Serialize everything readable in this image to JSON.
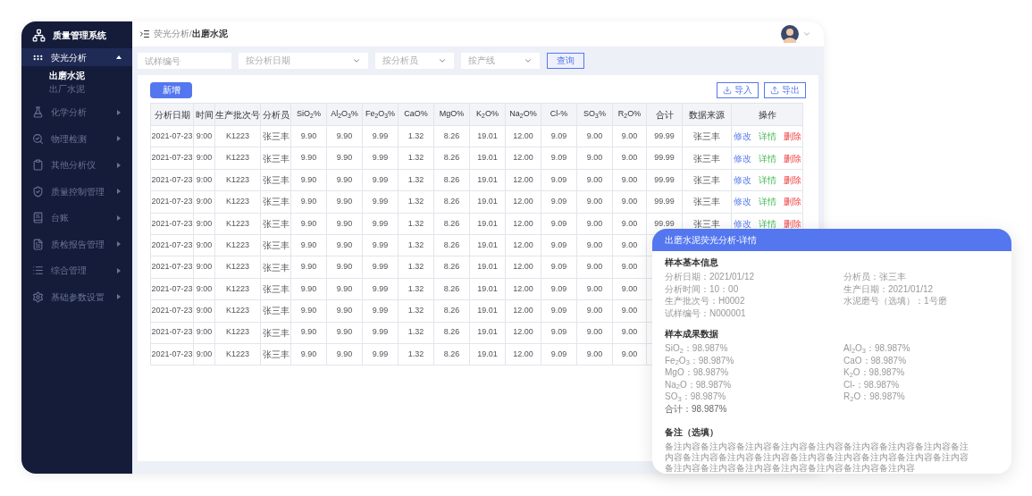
{
  "sidebar": {
    "title": "质量管理系统",
    "items": [
      {
        "label": "荧光分析",
        "expanded": true,
        "selected": true,
        "children": [
          {
            "label": "出磨水泥",
            "selected": true
          },
          {
            "label": "出厂水泥",
            "selected": false
          }
        ]
      },
      {
        "label": "化学分析",
        "expanded": false,
        "selected": false
      },
      {
        "label": "物理检测",
        "expanded": false,
        "selected": false
      },
      {
        "label": "其他分析仪",
        "expanded": false,
        "selected": false
      },
      {
        "label": "质量控制管理",
        "expanded": false,
        "selected": false
      },
      {
        "label": "台账",
        "expanded": false,
        "selected": false
      },
      {
        "label": "质检报告管理",
        "expanded": false,
        "selected": false
      },
      {
        "label": "综合管理",
        "expanded": false,
        "selected": false
      },
      {
        "label": "基础参数设置",
        "expanded": false,
        "selected": false
      }
    ]
  },
  "breadcrumb": {
    "parent": "荧光分析/",
    "current": "出磨水泥"
  },
  "filters": [
    {
      "kind": "input",
      "placeholder": "试样编号"
    },
    {
      "kind": "select",
      "placeholder": "按分析日期"
    },
    {
      "kind": "select",
      "placeholder": "按分析员"
    },
    {
      "kind": "select",
      "placeholder": "按产线"
    }
  ],
  "query_button": "查询",
  "add_button": "新增",
  "import_button": "导入",
  "export_button": "导出",
  "table": {
    "columns": [
      "分析日期",
      "时间",
      "生产批次号",
      "分析员",
      "SiO$_{2}$%",
      "Al$_{2}$O$_{3}$%",
      "Fe$_{2}$O$_{3}$%",
      "CaO%",
      "MgO%",
      "K$_{2}$O%",
      "Na$_{2}$O%",
      "Cl-%",
      "SO$_{3}$%",
      "R$_{2}$O%",
      "合计",
      "数据来源",
      "操作"
    ],
    "rows": [
      {
        "cells": [
          "2021-07-23",
          "9:00",
          "K1223",
          "张三丰",
          "9.90",
          "9.90",
          "9.99",
          "1.32",
          "8.26",
          "19.01",
          "12.00",
          "9.09",
          "9.00",
          "9.00",
          "99.99",
          "张三丰"
        ],
        "actions": [
          {
            "kind": "edit",
            "label": "修改"
          },
          {
            "kind": "detail",
            "label": "详情"
          },
          {
            "kind": "delete",
            "label": "删除"
          }
        ]
      },
      {
        "cells": [
          "2021-07-23",
          "9:00",
          "K1223",
          "张三丰",
          "9.90",
          "9.90",
          "9.99",
          "1.32",
          "8.26",
          "19.01",
          "12.00",
          "9.09",
          "9.00",
          "9.00",
          "99.99",
          "张三丰"
        ],
        "actions": [
          {
            "kind": "edit",
            "label": "修改"
          },
          {
            "kind": "detail",
            "label": "详情"
          },
          {
            "kind": "delete",
            "label": "删除"
          }
        ]
      },
      {
        "cells": [
          "2021-07-23",
          "9:00",
          "K1223",
          "张三丰",
          "9.90",
          "9.90",
          "9.99",
          "1.32",
          "8.26",
          "19.01",
          "12.00",
          "9.09",
          "9.00",
          "9.00",
          "99.99",
          "张三丰"
        ],
        "actions": [
          {
            "kind": "edit",
            "label": "修改"
          },
          {
            "kind": "detail",
            "label": "详情"
          },
          {
            "kind": "delete",
            "label": "删除"
          }
        ]
      },
      {
        "cells": [
          "2021-07-23",
          "9:00",
          "K1223",
          "张三丰",
          "9.90",
          "9.90",
          "9.99",
          "1.32",
          "8.26",
          "19.01",
          "12.00",
          "9.09",
          "9.00",
          "9.00",
          "99.99",
          "张三丰"
        ],
        "actions": [
          {
            "kind": "edit",
            "label": "修改"
          },
          {
            "kind": "detail",
            "label": "详情"
          },
          {
            "kind": "delete",
            "label": "删除"
          }
        ]
      },
      {
        "cells": [
          "2021-07-23",
          "9:00",
          "K1223",
          "张三丰",
          "9.90",
          "9.90",
          "9.99",
          "1.32",
          "8.26",
          "19.01",
          "12.00",
          "9.09",
          "9.00",
          "9.00",
          "99.99",
          "张三丰"
        ],
        "actions": [
          {
            "kind": "edit",
            "label": "修改"
          },
          {
            "kind": "detail",
            "label": "详情"
          },
          {
            "kind": "delete",
            "label": "删除"
          }
        ]
      },
      {
        "cells": [
          "2021-07-23",
          "9:00",
          "K1223",
          "张三丰",
          "9.90",
          "9.90",
          "9.99",
          "1.32",
          "8.26",
          "19.01",
          "12.00",
          "9.09",
          "9.00",
          "9.00"
        ]
      },
      {
        "cells": [
          "2021-07-23",
          "9:00",
          "K1223",
          "张三丰",
          "9.90",
          "9.90",
          "9.99",
          "1.32",
          "8.26",
          "19.01",
          "12.00",
          "9.09",
          "9.00",
          "9.00"
        ]
      },
      {
        "cells": [
          "2021-07-23",
          "9:00",
          "K1223",
          "张三丰",
          "9.90",
          "9.90",
          "9.99",
          "1.32",
          "8.26",
          "19.01",
          "12.00",
          "9.09",
          "9.00",
          "9.00"
        ]
      },
      {
        "cells": [
          "2021-07-23",
          "9:00",
          "K1223",
          "张三丰",
          "9.90",
          "9.90",
          "9.99",
          "1.32",
          "8.26",
          "19.01",
          "12.00",
          "9.09",
          "9.00",
          "9.00"
        ]
      },
      {
        "cells": [
          "2021-07-23",
          "9:00",
          "K1223",
          "张三丰",
          "9.90",
          "9.90",
          "9.99",
          "1.32",
          "8.26",
          "19.01",
          "12.00",
          "9.09",
          "9.00",
          "9.00"
        ]
      },
      {
        "cells": [
          "2021-07-23",
          "9:00",
          "K1223",
          "张三丰",
          "9.90",
          "9.90",
          "9.99",
          "1.32",
          "8.26",
          "19.01",
          "12.00",
          "9.09",
          "9.00",
          "9.00"
        ]
      }
    ]
  },
  "detail": {
    "title": "出磨水泥荧光分析-详情",
    "basic_title": "样本基本信息",
    "basic_left": [
      "分析日期：2021/01/12",
      "分析时间：10：00",
      "生产批次号：H0002",
      "试样编号：N000001"
    ],
    "basic_right": [
      "分析员：张三丰",
      "生产日期：2021/01/12",
      "水泥磨号（选填）：1号磨"
    ],
    "results_title": "样本成果数据",
    "results_left": [
      "SiO$_{2}$：98.987%",
      "Fe$_{2}$O$_{3}$：98.987%",
      "MgO：98.987%",
      "Na$_{2}$O：98.987%",
      "SO$_{3}$：98.987%"
    ],
    "results_right": [
      "Al$_{2}$O$_{3}$：98.987%",
      "CaO：98.987%",
      "K$_{2}$O：98.987%",
      "Cl-：98.987%",
      "R$_{2}$O：98.987%"
    ],
    "total": "合计：98.987%",
    "remark_title": "备注（选填）",
    "remark": "备注内容备注内容备注内容备注内容备注内容备注内容备注内容备注内容备注内容备注内容备注内容备注内容备注内容备注内容备注内容备注内容备注内容备注内容备注内容备注内容备注内容备注内容备注内容备注内容"
  }
}
